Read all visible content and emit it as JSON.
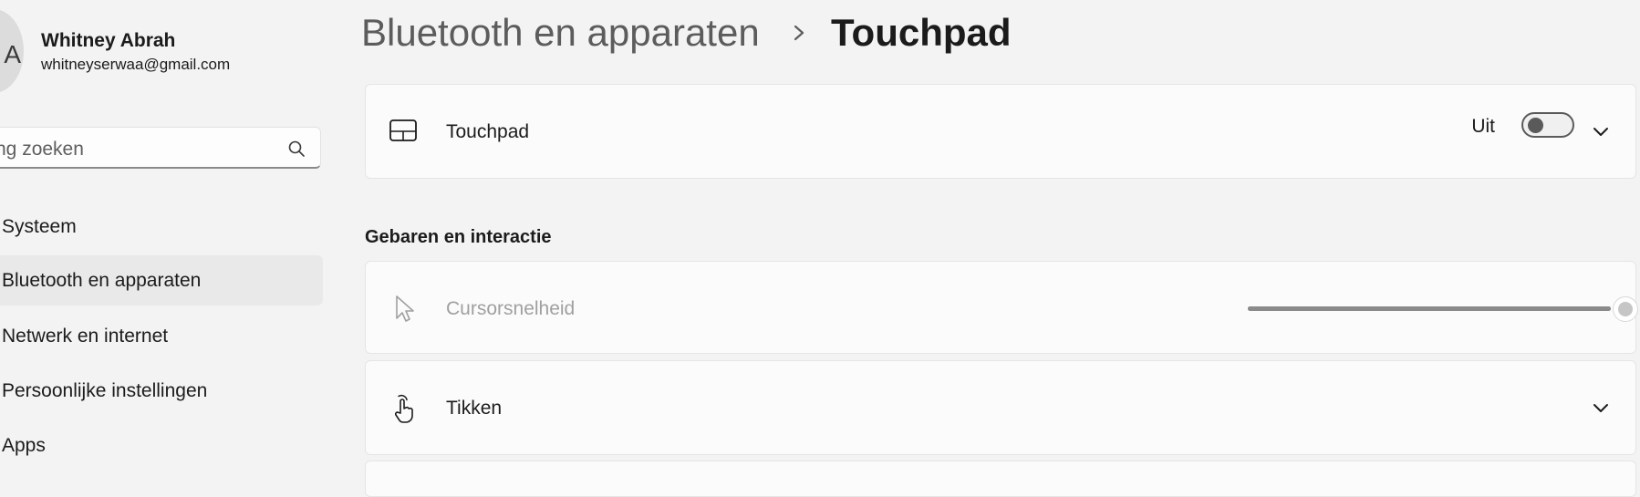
{
  "user": {
    "name": "Whitney Abrah",
    "email": "whitneyserwaa@gmail.com",
    "avatar_letter": "A"
  },
  "search": {
    "placeholder": "Instelling zoeken",
    "visible_text": "lling zoeken"
  },
  "sidebar": {
    "items": [
      {
        "label": "Systeem",
        "active": false
      },
      {
        "label": "Bluetooth en apparaten",
        "active": true
      },
      {
        "label": "Netwerk en internet",
        "active": false
      },
      {
        "label": "Persoonlijke instellingen",
        "active": false
      },
      {
        "label": "Apps",
        "active": false
      }
    ]
  },
  "header": {
    "parent": "Bluetooth en apparaten",
    "separator_icon": "chevron-right-icon",
    "current": "Touchpad"
  },
  "touchpad_card": {
    "icon": "touchpad-icon",
    "label": "Touchpad",
    "toggle_state": "Uit",
    "toggle_on": false
  },
  "section": {
    "title": "Gebaren en interactie"
  },
  "cursor_card": {
    "icon": "cursor-icon",
    "label": "Cursorsnelheid",
    "disabled": true,
    "slider_value_fraction": 1.0
  },
  "tap_card": {
    "icon": "tap-hand-icon",
    "label": "Tikken"
  },
  "colors": {
    "background": "#f3f3f3",
    "card": "#fbfbfb",
    "active_nav": "#e9e9e9",
    "disabled_text": "#a0a0a0"
  }
}
